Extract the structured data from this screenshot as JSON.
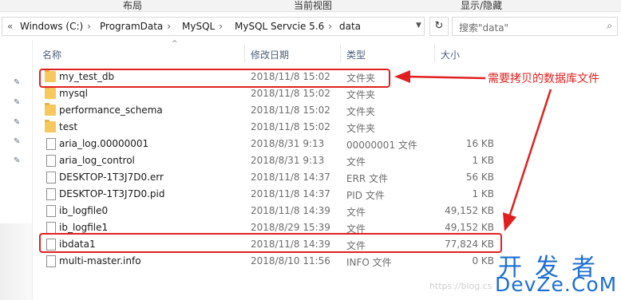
{
  "ribbon": {
    "tabs": [
      "布局",
      "当前视图",
      "显示/隐藏"
    ]
  },
  "address": {
    "crumbs": [
      "Windows (C:)",
      "ProgramData",
      "MySQL",
      "MySQL Servcie 5.6",
      "data"
    ],
    "search_placeholder": "搜索\"data\""
  },
  "columns": {
    "name": "名称",
    "date": "修改日期",
    "type": "类型",
    "size": "大小"
  },
  "files": [
    {
      "name": "my_test_db",
      "date": "2018/11/8 15:02",
      "type": "文件夹",
      "size": "",
      "kind": "folder"
    },
    {
      "name": "mysql",
      "date": "2018/11/8 15:02",
      "type": "文件夹",
      "size": "",
      "kind": "folder"
    },
    {
      "name": "performance_schema",
      "date": "2018/11/8 15:02",
      "type": "文件夹",
      "size": "",
      "kind": "folder"
    },
    {
      "name": "test",
      "date": "2018/11/8 15:02",
      "type": "文件夹",
      "size": "",
      "kind": "folder"
    },
    {
      "name": "aria_log.00000001",
      "date": "2018/8/31 9:13",
      "type": "00000001 文件",
      "size": "16 KB",
      "kind": "file"
    },
    {
      "name": "aria_log_control",
      "date": "2018/8/31 9:13",
      "type": "文件",
      "size": "1 KB",
      "kind": "file"
    },
    {
      "name": "DESKTOP-1T3J7D0.err",
      "date": "2018/11/8 14:37",
      "type": "ERR 文件",
      "size": "56 KB",
      "kind": "file"
    },
    {
      "name": "DESKTOP-1T3J7D0.pid",
      "date": "2018/11/8 14:37",
      "type": "PID 文件",
      "size": "1 KB",
      "kind": "file"
    },
    {
      "name": "ib_logfile0",
      "date": "2018/11/8 14:39",
      "type": "文件",
      "size": "49,152 KB",
      "kind": "file"
    },
    {
      "name": "ib_logfile1",
      "date": "2018/8/29 15:39",
      "type": "文件",
      "size": "49,152 KB",
      "kind": "file"
    },
    {
      "name": "ibdata1",
      "date": "2018/11/8 14:39",
      "type": "文件",
      "size": "77,824 KB",
      "kind": "file"
    },
    {
      "name": "multi-master.info",
      "date": "2018/8/10 11:56",
      "type": "INFO 文件",
      "size": "0 KB",
      "kind": "file"
    }
  ],
  "annotation": {
    "text": "需要拷贝的数据库文件",
    "color": "#e02020"
  },
  "watermark": {
    "line1": "开发者",
    "line2": "DevZe.CoM",
    "blog": "https://blog.cs"
  },
  "colors": {
    "folder": "#f7c85d",
    "accent_red": "#e02020",
    "header_text": "#4c607a"
  }
}
